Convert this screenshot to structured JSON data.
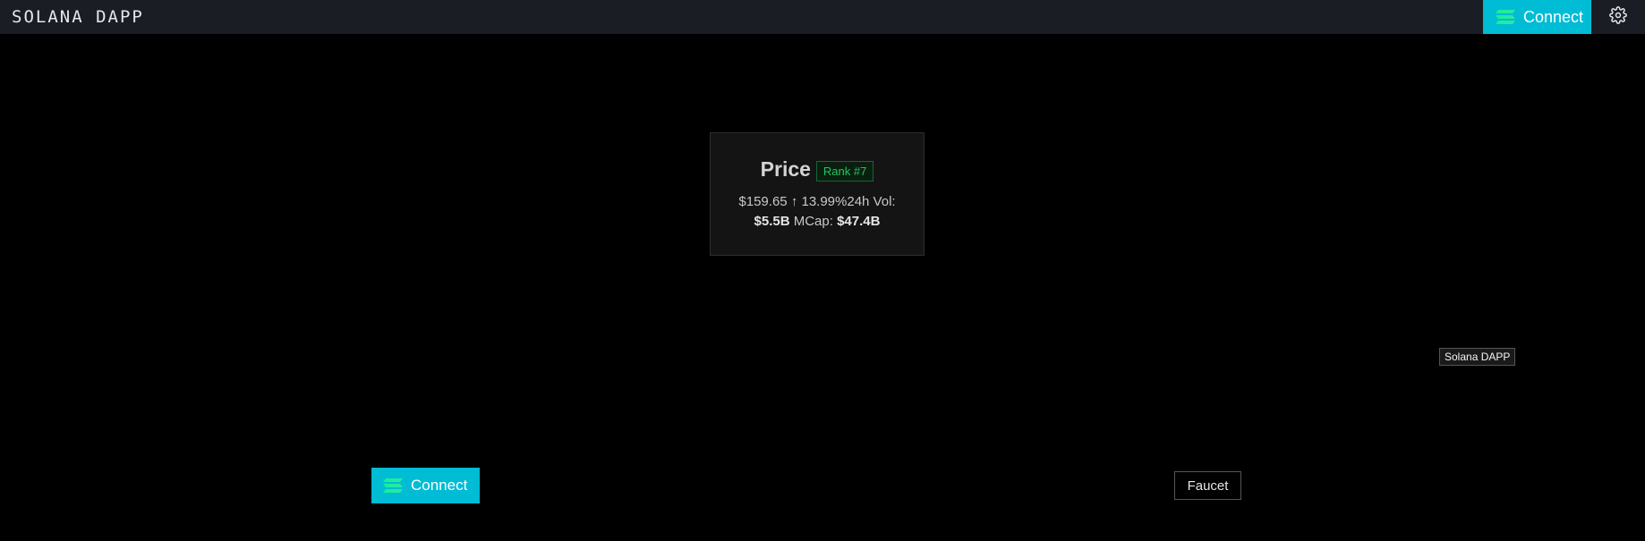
{
  "navbar": {
    "brand": "SOLANA DAPP",
    "connect_label": "Connect",
    "settings_icon": "gear-icon"
  },
  "price_card": {
    "title": "Price",
    "rank": "Rank #7",
    "price": "$159.65",
    "change_arrow": "↑",
    "change": "13.99%",
    "volume_label": "24h Vol:",
    "volume": "$5.5B",
    "mcap_label": "MCap:",
    "mcap": "$47.4B"
  },
  "tooltip": {
    "text": "Solana DAPP"
  },
  "actions": {
    "connect_label": "Connect",
    "faucet_label": "Faucet"
  },
  "colors": {
    "accent": "#00bcd4",
    "navbar_bg": "#1a1d24",
    "rank_green": "#22c55e"
  }
}
